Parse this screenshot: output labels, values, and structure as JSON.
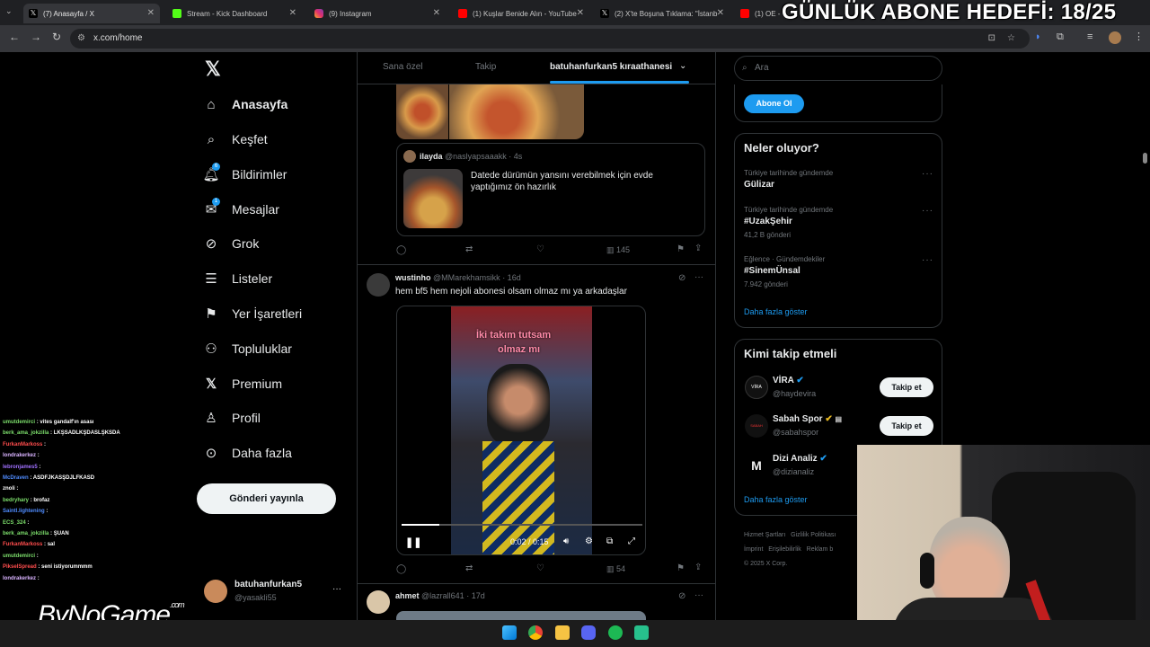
{
  "browser": {
    "tabs": [
      {
        "label": "(7) Anasayfa / X",
        "active": true
      },
      {
        "label": "Stream - Kick Dashboard"
      },
      {
        "label": "(9) Instagram"
      },
      {
        "label": "(1) Kuşlar Benide Alın - YouTube"
      },
      {
        "label": "(2) X'te Boşuna Tıklama: \"İstanb"
      },
      {
        "label": "(1) OE -"
      }
    ],
    "url": "x.com/home"
  },
  "overlay": {
    "title": "GÜNLÜK ABONE HEDEFİ: 18/25",
    "logo": "ByNoGame",
    "logo_sub": ".com"
  },
  "sidebar": {
    "items": [
      {
        "label": "Anasayfa",
        "icon": "home-icon"
      },
      {
        "label": "Keşfet",
        "icon": "search-icon"
      },
      {
        "label": "Bildirimler",
        "icon": "bell-icon",
        "badge": "6"
      },
      {
        "label": "Mesajlar",
        "icon": "mail-icon",
        "badge": "1"
      },
      {
        "label": "Grok",
        "icon": "grok-icon"
      },
      {
        "label": "Listeler",
        "icon": "list-icon"
      },
      {
        "label": "Yer İşaretleri",
        "icon": "bookmark-icon"
      },
      {
        "label": "Topluluklar",
        "icon": "communities-icon"
      },
      {
        "label": "Premium",
        "icon": "x-logo-icon"
      },
      {
        "label": "Profil",
        "icon": "person-icon"
      },
      {
        "label": "Daha fazla",
        "icon": "more-circle-icon"
      }
    ],
    "post_button": "Gönderi yayınla",
    "account": {
      "name": "batuhanfurkan5",
      "handle": "@yasakli55"
    }
  },
  "feed": {
    "tabs": [
      "Sana özel",
      "Takip",
      "batuhanfurkan5 kıraathanesi"
    ],
    "quote": {
      "name": "ilayda",
      "handle": "@naslyapsaaakk",
      "time": "· 4s",
      "text": "Datede dürümün yansını verebilmek için evde yaptığımız ön hazırlık"
    },
    "post1_views": "145",
    "post2": {
      "name": "wustinho",
      "handle": "@MMarekhamsikk",
      "time": "· 16d",
      "text": "hem bf5 hem nejoli abonesi olsam olmaz mı ya arkadaşlar",
      "video_caption_1": "İki takım tutsam",
      "video_caption_2": "olmaz mı",
      "video_time": "0:02 / 0:15",
      "views": "54"
    },
    "post3": {
      "name": "ahmet",
      "handle": "@lazrall641",
      "time": "· 17d"
    }
  },
  "right": {
    "search_placeholder": "Ara",
    "subscribe_button": "Abone Ol",
    "trends_title": "Neler oluyor?",
    "trends": [
      {
        "context": "Türkiye tarihinde gündemde",
        "topic": "Gülizar",
        "count": ""
      },
      {
        "context": "Türkiye tarihinde gündemde",
        "topic": "#UzakŞehir",
        "count": "41,2 B gönderi"
      },
      {
        "context": "Eğlence · Gündemdekiler",
        "topic": "#SinemÜnsal",
        "count": "7.942 gönderi"
      }
    ],
    "show_more": "Daha fazla göster",
    "who_title": "Kimi takip etmeli",
    "who": [
      {
        "name": "VİRA",
        "handle": "@haydevira",
        "button": "Takip et"
      },
      {
        "name": "Sabah Spor",
        "handle": "@sabahspor",
        "button": "Takip et"
      },
      {
        "name": "Dizi Analiz",
        "handle": "@dizianaliz",
        "button": ""
      }
    ],
    "who_more": "Daha fazla göster",
    "footer": [
      "Hizmet Şartları",
      "Gizlilik Politikası",
      "İmprint",
      "Erişilebilirlik",
      "Reklam b",
      "© 2025 X Corp."
    ]
  },
  "chat": [
    {
      "user": "umutdemirci",
      "msg": ": vites gandalf'ın asası",
      "color": "#7ddf6c"
    },
    {
      "user": "berk_ama_jokzilla",
      "msg": ": LKŞSADLKŞDASLŞKSDA",
      "color": "#7ddf6c"
    },
    {
      "user": "FurkanMarkoss",
      "msg": ":",
      "color": "#ff4d4d"
    },
    {
      "user": "londrakerkez",
      "msg": ":",
      "color": "#d9b3ff"
    },
    {
      "user": "lebronjames5",
      "msg": ":",
      "color": "#a070ff"
    },
    {
      "user": "McDraven",
      "msg": ": ASDFJKASŞDJLFKASD",
      "color": "#4f8cff"
    },
    {
      "user": "znoli",
      "msg": ":",
      "color": "#ffffff"
    },
    {
      "user": "bedryhary",
      "msg": ": brofaz",
      "color": "#7ddf6c"
    },
    {
      "user": "Saintl.lightening",
      "msg": ":",
      "color": "#4f8cff"
    },
    {
      "user": "ECS_324",
      "msg": ":",
      "color": "#7ddf6c"
    },
    {
      "user": "berk_ama_jokzilla",
      "msg": ": ŞUAN",
      "color": "#7ddf6c"
    },
    {
      "user": "FurkanMarkoss",
      "msg": ": sal",
      "color": "#ff4d4d"
    },
    {
      "user": "umutdemirci",
      "msg": ":",
      "color": "#7ddf6c"
    },
    {
      "user": "PikselSpread",
      "msg": ": seni istiyorummmm",
      "color": "#ff4d4d"
    },
    {
      "user": "londrakerkez",
      "msg": ":",
      "color": "#d9b3ff"
    }
  ]
}
